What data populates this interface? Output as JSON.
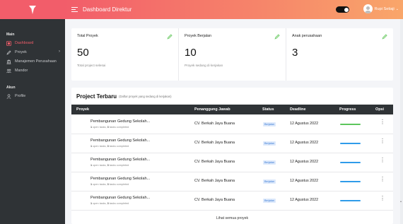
{
  "header": {
    "title": "Dashboard Direktur",
    "user_name": "Rupi Setiaji",
    "colors": {
      "accent": "#f25d6a",
      "gradient_end": "#f9a66a",
      "sidebar": "#2f3336"
    }
  },
  "sidebar": {
    "section_main": "Main",
    "section_account": "Akun",
    "items": [
      {
        "label": "Dashboard",
        "icon": "dashboard-icon",
        "active": true
      },
      {
        "label": "Proyek",
        "icon": "pencil-icon",
        "active": false
      },
      {
        "label": "Manajemen Perusahaan",
        "icon": "building-icon",
        "active": false
      },
      {
        "label": "Mandor",
        "icon": "users-icon",
        "active": false
      },
      {
        "label": "Profile",
        "icon": "user-icon",
        "active": false
      }
    ]
  },
  "stats": [
    {
      "title": "Total Proyek",
      "value": "50",
      "sub": "Total project selesai"
    },
    {
      "title": "Proyek Berjalan",
      "value": "10",
      "sub": "Proyek sedang di kerjakan"
    },
    {
      "title": "Anak perusahaan",
      "value": "3",
      "sub": ""
    }
  ],
  "projects": {
    "title": "Project Terbaru",
    "subtitle": "(Daftar proyek yang sedang di kerjakan)",
    "columns": {
      "name": "Proyek",
      "pic": "Penanggung Jawab",
      "status": "Status",
      "deadline": "Deadline",
      "progress": "Progress",
      "options": "Opsi"
    },
    "rows": [
      {
        "name": "Pembangunan Gedung Sekolah...",
        "open": "1",
        "done": "3",
        "pic": "CV. Berkah Jaya Buana",
        "status": "Berjalan",
        "deadline": "12 Agustus 2022",
        "progress_color": "#5cc65c",
        "progress": 0.95
      },
      {
        "name": "Pembangunan Gedung Sekolah...",
        "open": "1",
        "done": "3",
        "pic": "CV. Berkah Jaya Buana",
        "status": "Berjalan",
        "deadline": "12 Agustus 2022",
        "progress_color": "#2f9be9",
        "progress": 0.95
      },
      {
        "name": "Pembangunan Gedung Sekolah...",
        "open": "1",
        "done": "3",
        "pic": "CV. Berkah Jaya Buana",
        "status": "Berjalan",
        "deadline": "12 Agustus 2022",
        "progress_color": "#2f9be9",
        "progress": 0.95
      },
      {
        "name": "Pembangunan Gedung Sekolah...",
        "open": "1",
        "done": "3",
        "pic": "CV. Berkah Jaya Buana",
        "status": "Berjalan",
        "deadline": "12 Agustus 2022",
        "progress_color": "#2f9be9",
        "progress": 0.95
      },
      {
        "name": "Pembangunan Gedung Sekolah...",
        "open": "1",
        "done": "3",
        "pic": "CV. Berkah Jaya Buana",
        "status": "Berjalan",
        "deadline": "12 Agustus 2022",
        "progress_color": "#2f9be9",
        "progress": 0.95
      }
    ],
    "open_label": "open tasks,",
    "done_label": "tasks completed",
    "see_all": "Lihat semua proyek"
  }
}
